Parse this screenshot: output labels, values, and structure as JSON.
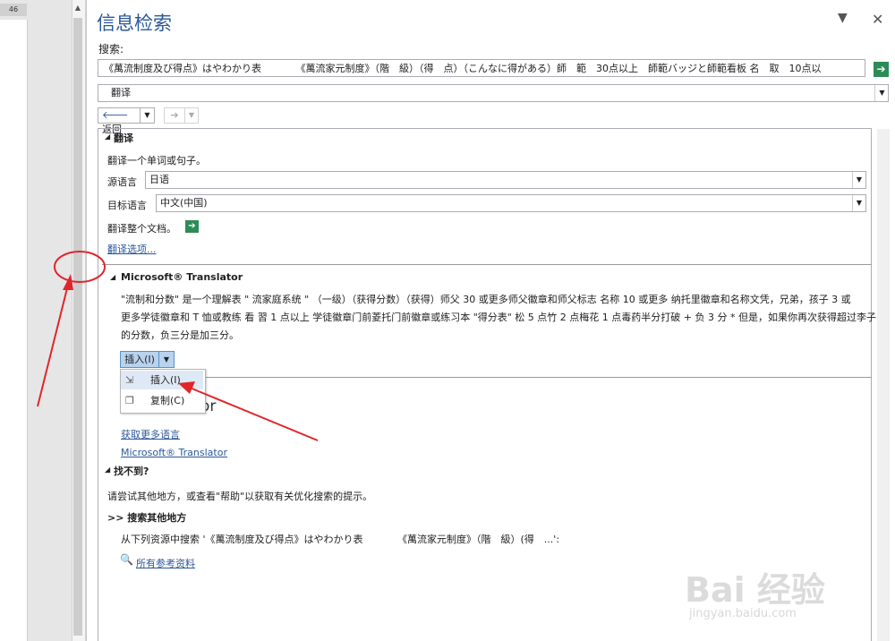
{
  "doc": {
    "tab_label": "46"
  },
  "pane": {
    "title": "信息检索",
    "menu_icon": "▼",
    "close_icon": "✕",
    "search_label": "搜索:",
    "search_value": "《萬流制度及び得点》はやわかり表　　　　《萬流家元制度》（階　級）（得　点）（こんなに得がある）師　範　30点以上　師範バッジと師範看板 名　取　10点以",
    "service_value": "翻译",
    "back_label": "返回"
  },
  "translate": {
    "heading": "翻译",
    "description": "翻译一个单词或句子。",
    "source_label": "源语言",
    "source_value": "日语",
    "target_label": "目标语言",
    "target_value": "中文(中国)",
    "whole_doc_label": "翻译整个文档。",
    "options_link": "翻译选项..."
  },
  "ms_translator": {
    "heading": "Microsoft® Translator",
    "line1": "\"流制和分数\" 是一个理解表 \" 流家庭系统 \" （一级）（获得分数）（获得）师父 30 或更多师父徽章和师父标志 名称 10 或更多 纳托里徽章和名称文凭，兄弟，孩子 3 或",
    "line2": "更多学徒徽章和 T 恤或教练 看 習 1 点以上 学徒徽章门前菱托门前徽章或练习本 \"得分表\" 松 5 点竹 2 点梅花 1 点毒药半分打破 + 负 3 分 * 但是，如果你再次获得超过李子",
    "line3": "的分数，负三分是加三分。",
    "insert_button": "插入(I)",
    "hidden_text": "or"
  },
  "context_menu": {
    "insert": "插入(I)",
    "copy": "复制(C)"
  },
  "more": {
    "more_languages": "获取更多语言",
    "ms_link": "Microsoft® Translator"
  },
  "not_found": {
    "heading": "找不到?",
    "hint": "请尝试其他地方，或查看\"帮助\"以获取有关优化搜索的提示。",
    "search_other": ">> 搜索其他地方",
    "search_from": "从下列资源中搜索 '《萬流制度及び得点》はやわかり表　　　　《萬流家元制度》（階　級）(得　...':",
    "all_refs": "所有参考资料"
  },
  "watermark": {
    "brand": "Bai 经验",
    "url": "jingyan.baidu.com"
  },
  "colors": {
    "title_blue": "#2b579a",
    "go_green": "#2e8b57",
    "annotation_red": "#e0262b",
    "menu_highlight": "#dfe9f5"
  }
}
